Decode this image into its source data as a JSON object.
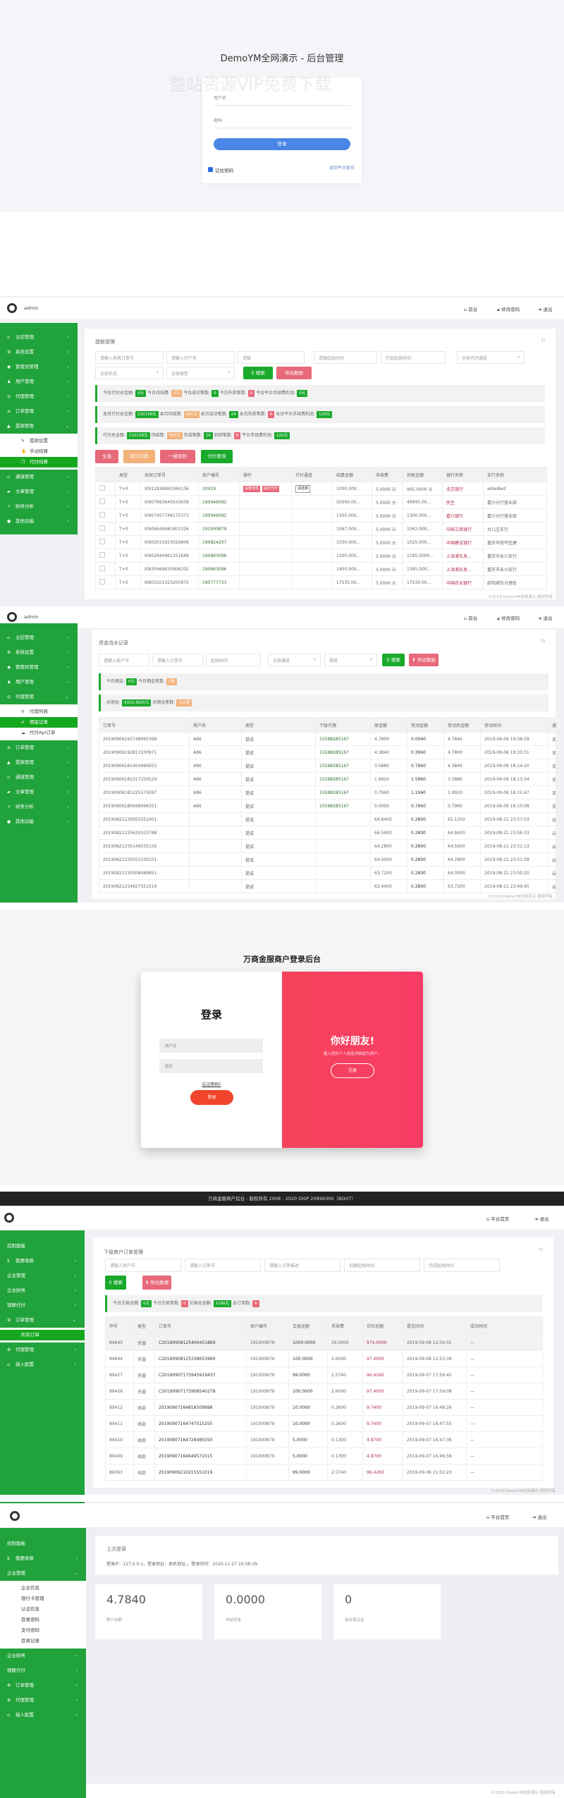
{
  "colors": {
    "brand_green": "#21a33b",
    "danger_pink": "#e8697a",
    "warning_orange": "#f3b27a",
    "login_blue": "#4a86e8",
    "login2_red": "#f5455c"
  },
  "login1": {
    "title": "DemoYM全网演示 - 后台管理",
    "username_placeholder": "用户名",
    "password_placeholder": "密码",
    "login_button": "登录",
    "remember_label": "记住密码",
    "remember_checked": true,
    "back_link": "返回平台首页"
  },
  "admin_header": {
    "username": "admin",
    "links": [
      {
        "icon": "home-icon",
        "label": "前台"
      },
      {
        "icon": "lock-icon",
        "label": "修改密码"
      },
      {
        "icon": "logout-icon",
        "label": "退出"
      }
    ]
  },
  "withdraw": {
    "sidebar": [
      {
        "icon": "home-icon",
        "label": "主控管理"
      },
      {
        "icon": "cogs-icon",
        "label": "系统设置"
      },
      {
        "icon": "user-circle-icon",
        "label": "管理员管理"
      },
      {
        "icon": "users-icon",
        "label": "用户管理"
      },
      {
        "icon": "eye-icon",
        "label": "代理管理"
      },
      {
        "icon": "list-icon",
        "label": "订单管理"
      },
      {
        "icon": "lock-icon",
        "label": "提款管理",
        "expanded": true,
        "children": [
          {
            "icon": "wrench-icon",
            "label": "提款设置"
          },
          {
            "icon": "hand-icon",
            "label": "手动结算"
          },
          {
            "icon": "copy-icon",
            "label": "代付结算",
            "active": true
          }
        ]
      },
      {
        "icon": "bank-icon",
        "label": "通道管理"
      },
      {
        "icon": "book-icon",
        "label": "文章管理"
      },
      {
        "icon": "chart-icon",
        "label": "财务分析"
      },
      {
        "icon": "circle-icon",
        "label": "其他功能"
      }
    ],
    "title": "提款管理",
    "filters": {
      "order_no": "请输入系统订单号",
      "account_name": "请输入开户名",
      "other": "请输",
      "start_time": "请输起始时间",
      "pay_time": "打款起始时间",
      "channel": "全部代付通道",
      "status": "全部状态",
      "type": "全部类型"
    },
    "search_label": "搜索",
    "export_label": "导出数据",
    "stats": [
      [
        {
          "label": "今日代付总金额:",
          "value": "0元",
          "color": "g"
        },
        {
          "label": "今日待结算:",
          "value": "0元",
          "color": "o"
        },
        {
          "label": "今日成功笔数:",
          "value": "0",
          "color": "g"
        },
        {
          "label": "今日失败笔数:",
          "value": "0",
          "color": "p"
        },
        {
          "label": "今日平台手续费利润:",
          "value": "0元",
          "color": "g"
        }
      ],
      [
        {
          "label": "本月代付总金额:",
          "value": "210138元",
          "color": "g"
        },
        {
          "label": "本月待结算:",
          "value": "995元",
          "color": "o"
        },
        {
          "label": "本月成功笔数:",
          "value": "24",
          "color": "g"
        },
        {
          "label": "本月失败笔数:",
          "value": "6",
          "color": "p"
        },
        {
          "label": "本月平台手续费利润:",
          "value": "120元",
          "color": "g"
        }
      ],
      [
        {
          "label": "代付总金额:",
          "value": "210138元",
          "color": "g"
        },
        {
          "label": "待结算:",
          "value": "995元",
          "color": "o"
        },
        {
          "label": "完成笔数:",
          "value": "24",
          "color": "g"
        },
        {
          "label": "驳回笔数:",
          "value": "6",
          "color": "p"
        },
        {
          "label": "平台手续费利润:",
          "value": "120元",
          "color": "g"
        }
      ]
    ],
    "actions": [
      {
        "label": "全选",
        "color": "p"
      },
      {
        "label": "部分打款",
        "color": "o"
      },
      {
        "label": "一键驳回",
        "color": "p"
      },
      {
        "label": "代付查询",
        "color": "g"
      }
    ],
    "columns": [
      "",
      "类型",
      "系统订单号",
      "商户编号",
      "操作",
      "代付通道",
      "结算金额",
      "手续费",
      "到账金额",
      "银行名称",
      "支行名称"
    ],
    "row_actions": [
      "设置状态",
      "提交代付"
    ],
    "channel_select": "请选择",
    "rows": [
      [
        "T+0",
        "I0912938863360136",
        "10019",
        "1000.000...",
        "5.0000 元",
        "995.0000 元",
        "北京银行",
        "wdwdwd"
      ],
      [
        "T+0",
        "I0907693640543639",
        "190946092",
        "50000.00...",
        "5.0000 元",
        "49995.00...",
        "民生",
        "嘉兴分行营业部"
      ],
      [
        "T+0",
        "I0907457748175373",
        "190946092",
        "1305.000...",
        "5.0000 元",
        "1300.000...",
        "嘉兴银行",
        "嘉兴分行营业部"
      ],
      [
        "T+0",
        "I0906649481801326",
        "191000879",
        "1067.000...",
        "5.0000 元",
        "1062.000...",
        "中国工商银行",
        "台儿庄支行"
      ],
      [
        "T+0",
        "I0902015023026806",
        "190824207",
        "1030.000...",
        "5.0000 元",
        "1025.000...",
        "中国建设银行",
        "重庆市南坪区建"
      ],
      [
        "T+0",
        "I0902944961151649",
        "190863096",
        "1200.000...",
        "5.0000 元",
        "1195.0000...",
        "上海浦东发...",
        "重庆市永川支行"
      ],
      [
        "T+0",
        "I0830469635806332",
        "190863096",
        "1400.000...",
        "5.0000 元",
        "1395.000...",
        "上海浦东发...",
        "重庆市永川支行"
      ],
      [
        "T+0",
        "I0803101023205970",
        "190777733",
        "17535.00...",
        "5.0000 元",
        "17530.00...",
        "中国农业银行",
        "邵阳城东分理处"
      ]
    ],
    "footer": "©2018 DemoYM全网演示 版权所有"
  },
  "commission": {
    "sidebar": [
      {
        "icon": "home-icon",
        "label": "主控管理"
      },
      {
        "icon": "cogs-icon",
        "label": "系统设置"
      },
      {
        "icon": "user-circle-icon",
        "label": "管理员管理"
      },
      {
        "icon": "users-icon",
        "label": "用户管理"
      },
      {
        "icon": "eye-icon",
        "label": "代理管理",
        "expanded": true,
        "children": [
          {
            "icon": "search-icon",
            "label": "代理列表"
          },
          {
            "icon": "thumb-icon",
            "label": "佣金记录",
            "active": true
          },
          {
            "icon": "cloud-icon",
            "label": "代付Api订单"
          }
        ]
      },
      {
        "icon": "list-icon",
        "label": "订单管理"
      },
      {
        "icon": "lock-icon",
        "label": "提款管理"
      },
      {
        "icon": "bank-icon",
        "label": "通道管理"
      },
      {
        "icon": "book-icon",
        "label": "文章管理"
      },
      {
        "icon": "chart-icon",
        "label": "财务分析"
      },
      {
        "icon": "circle-icon",
        "label": "其他功能"
      }
    ],
    "title": "资金流水记录",
    "filters": {
      "merchant": "请输入商户号",
      "order": "请输入订单号",
      "start": "起始时间",
      "channel": "全部通道",
      "type": "提成"
    },
    "search_label": "搜索",
    "export_label": "导出数据",
    "stats": [
      [
        {
          "label": "今日佣金:",
          "value": "0元",
          "color": "g"
        },
        {
          "label": "今日佣金笔数:",
          "value": "0笔",
          "color": "o"
        }
      ],
      [
        {
          "label": "总佣金:",
          "value": "9310.3625元",
          "color": "g"
        },
        {
          "label": "总佣金笔数:",
          "value": "339笔",
          "color": "o"
        }
      ]
    ],
    "columns": [
      "订单号",
      "商户名",
      "类型",
      "下级代理",
      "原金额",
      "变动金额",
      "变动后金额",
      "变动时间",
      "通"
    ],
    "rows": [
      [
        "20190906193748995399",
        "A86",
        "提成",
        "15588285167",
        "4.7800",
        "0.0040",
        "4.7840",
        "2019-09-06 19:38:29",
        "支"
      ],
      [
        "20190906192813100971",
        "A86",
        "提成",
        "15588285167",
        "4.3840",
        "0.3960",
        "4.7800",
        "2019-09-06 19:30:51",
        "支"
      ],
      [
        "20190906181404996653",
        "A86",
        "提成",
        "15588285167",
        "3.5880",
        "0.7960",
        "4.3840",
        "2019-09-06 18:14:20",
        "支"
      ],
      [
        "20190906181317100529",
        "A86",
        "提成",
        "15588285167",
        "1.9920",
        "1.5960",
        "3.5880",
        "2019-09-06 18:13:34",
        "支"
      ],
      [
        "20190906181225575097",
        "A86",
        "提成",
        "15588285167",
        "0.7960",
        "1.1960",
        "1.9920",
        "2019-09-06 18:12:47",
        "支"
      ],
      [
        "20190906180948996351",
        "A86",
        "提成",
        "15588285167",
        "0.0000",
        "0.7960",
        "0.7960",
        "2019-09-06 18:10:08",
        "支"
      ],
      [
        "20190821235655551001",
        "",
        "提成",
        "",
        "64.8400",
        "0.2800",
        "65.1200",
        "2019-08-21 23:57:03",
        "云"
      ],
      [
        "20190821235620525798",
        "",
        "提成",
        "",
        "64.5600",
        "0.2800",
        "64.8400",
        "2019-08-21 23:56:33",
        "云"
      ],
      [
        "20190821235149535156",
        "",
        "提成",
        "",
        "64.2800",
        "0.2800",
        "64.5600",
        "2019-08-21 23:52:13",
        "云"
      ],
      [
        "20190821235053100101",
        "",
        "提成",
        "",
        "64.0000",
        "0.2800",
        "64.2800",
        "2019-08-21 23:51:09",
        "云"
      ],
      [
        "20190821235008489851",
        "",
        "提成",
        "",
        "63.7200",
        "0.2800",
        "64.0000",
        "2019-08-21 23:50:20",
        "云"
      ],
      [
        "20190821234927551019",
        "",
        "提成",
        "",
        "63.4400",
        "0.2800",
        "63.7200",
        "2019-08-21 23:49:45",
        "云"
      ]
    ],
    "footer": "©2018 DemoYM全网演示 版权所有"
  },
  "login2": {
    "title": "万商金服商户登录后台",
    "heading": "登录",
    "username_placeholder": "用户名",
    "password_placeholder": "密码",
    "forgot_link": "忘记密码?",
    "login_button": "登录",
    "welcome_title": "你好朋友!",
    "welcome_text": "输入您的个人信息详细成为商户。",
    "register_button": "注册"
  },
  "merchant_orders": {
    "banner": "万商金服商户后台 - 版权所有 2008 - 2020 DISP 20999300（BOOT）",
    "header_links": [
      {
        "icon": "home-icon",
        "label": "平台首页"
      },
      {
        "icon": "logout-icon",
        "label": "退出"
      }
    ],
    "sidebar": [
      {
        "label": "控制面板",
        "icon": ""
      },
      {
        "icon": "dollar-icon",
        "label": "我要收款"
      },
      {
        "label": "企业管理",
        "icon": ""
      },
      {
        "label": "企业财务",
        "icon": ""
      },
      {
        "label": "银联代付",
        "icon": ""
      },
      {
        "icon": "cogs-icon",
        "label": "订单管理",
        "expanded": true,
        "children": [
          {
            "label": "所有订单",
            "active": true
          }
        ]
      },
      {
        "icon": "cogs-icon",
        "label": "代理管理"
      },
      {
        "icon": "bank-icon",
        "label": "接入配置"
      }
    ],
    "title": "下级商户订单管理",
    "filters": [
      "请输入商户号",
      "请输入订单号",
      "请输入订单描述",
      "创建起始时间",
      "完成起始时间"
    ],
    "search_label": "搜索",
    "export_label": "导出数据",
    "stats": [
      {
        "label": "今日交易总额:",
        "value": "0元",
        "color": "g"
      },
      {
        "label": "今日交易笔数:",
        "value": "0",
        "color": "p"
      },
      {
        "label": "交易总金额:",
        "value": "1196元",
        "color": "g"
      },
      {
        "label": "总订单数:",
        "value": "6",
        "color": "p"
      }
    ],
    "columns": [
      "序号",
      "类型",
      "订单号",
      "商户编号",
      "交易金额",
      "手续费",
      "实际金额",
      "提交时间",
      "成功时间"
    ],
    "rows": [
      [
        "89645",
        "充值",
        "C20190908125400451869",
        "191000879",
        "1000.0000",
        "26.0000",
        "974.0000",
        "2019-09-08 12:54:01",
        "—"
      ],
      [
        "89644",
        "充值",
        "C20190908125338653960",
        "191000879",
        "100.0000",
        "2.6000",
        "97.4000",
        "2019-09-08 12:53:39",
        "—"
      ],
      [
        "89427",
        "充值",
        "C20190907175945919437",
        "191000879",
        "99.0000",
        "2.5740",
        "96.4260",
        "2019-09-07 17:59:45",
        "—"
      ],
      [
        "89426",
        "充值",
        "C20190907175908540278",
        "191000879",
        "100.0000",
        "2.6000",
        "97.4000",
        "2019-09-07 17:59:08",
        "—"
      ],
      [
        "89412",
        "收款",
        "20190907164818509998",
        "191000879",
        "10.0000",
        "0.2600",
        "9.7400",
        "2019-09-07 16:48:26",
        "—"
      ],
      [
        "89411",
        "收款",
        "20190907164747515255",
        "191000879",
        "10.0000",
        "0.2600",
        "9.7400",
        "2019-09-07 16:47:55",
        "—"
      ],
      [
        "89410",
        "收款",
        "20190907164728485550",
        "191000879",
        "5.0000",
        "0.1300",
        "4.8700",
        "2019-09-07 16:47:36",
        "—"
      ],
      [
        "89409",
        "收款",
        "20190907164649571015",
        "191000879",
        "5.0000",
        "0.1300",
        "4.8700",
        "2019-09-07 16:46:58",
        "—"
      ],
      [
        "89363",
        "收款",
        "20190906210215551019",
        "",
        "99.0000",
        "2.5740",
        "96.4260",
        "2019-09-06 21:02:23",
        "—"
      ]
    ],
    "footer": "©2018 DemoYM全网演示 版权所有"
  },
  "merchant_dashboard": {
    "header_links": [
      {
        "icon": "home-icon",
        "label": "平台首页"
      },
      {
        "icon": "logout-icon",
        "label": "退出"
      }
    ],
    "sidebar": [
      {
        "label": "控制面板",
        "icon": ""
      },
      {
        "icon": "dollar-icon",
        "label": "我要收款"
      },
      {
        "label": "企业管理",
        "icon": "",
        "expanded": true,
        "children": [
          {
            "label": "企业信息"
          },
          {
            "label": "银行卡管理"
          },
          {
            "label": "认证信息"
          },
          {
            "label": "登录密码"
          },
          {
            "label": "支付密码"
          },
          {
            "label": "登录记录"
          }
        ]
      },
      {
        "label": "企业财务",
        "icon": ""
      },
      {
        "label": "银联代付",
        "icon": ""
      },
      {
        "icon": "cogs-icon",
        "label": "订单管理"
      },
      {
        "icon": "cogs-icon",
        "label": "代理管理"
      },
      {
        "icon": "bank-icon",
        "label": "接入配置"
      }
    ],
    "last_login_title": "上次登录",
    "last_login_info": "登录IP：127.0.0.1，登录地址：本机地址-，登录时间：2020-11-27 10:58:39",
    "cards": [
      {
        "value": "4.7840",
        "label": "账户余额"
      },
      {
        "value": "0.0000",
        "label": "冻结资金"
      },
      {
        "value": "0",
        "label": "投诉保证金"
      }
    ],
    "footer": "©2018 DemoYM全网演示 版权所有"
  }
}
